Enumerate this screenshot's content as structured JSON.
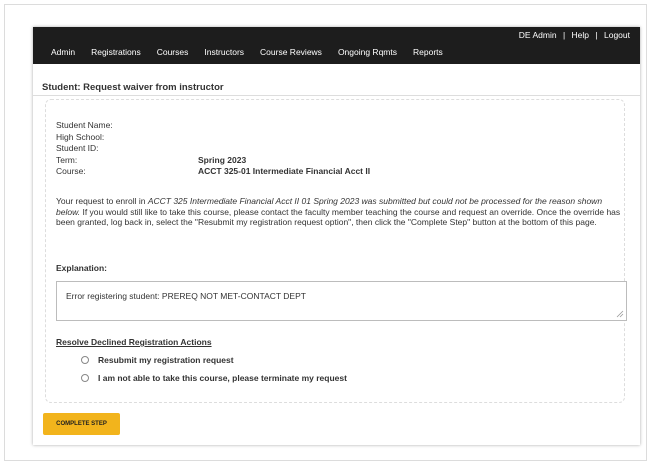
{
  "header": {
    "user_links": [
      "DE Admin",
      "Help",
      "Logout"
    ],
    "separator": "|",
    "menu": [
      "Admin",
      "Registrations",
      "Courses",
      "Instructors",
      "Course Reviews",
      "Ongoing Rqmts",
      "Reports"
    ]
  },
  "page": {
    "title": "Student: Request waiver from instructor"
  },
  "student_info": {
    "name_label": "Student Name:",
    "name_value": "",
    "school_label": "High School:",
    "school_value": "",
    "id_label": "Student ID:",
    "id_value": "",
    "term_label": "Term:",
    "term_value": "Spring 2023",
    "course_label": "Course:",
    "course_value": "ACCT 325-01 Intermediate Financial Acct II"
  },
  "message": {
    "lead": "Your request to enroll in ",
    "italic": "ACCT 325 Intermediate Financial Acct II 01 Spring 2023 was submitted but could not be processed for the reason shown below.",
    "rest": " If you would still like to take this course, please contact the faculty member teaching the course and request an override. Once the override has been granted, log back in, select the \"Resubmit my registration request option\", then click the \"Complete Step\" button at the bottom of this page."
  },
  "explanation": {
    "label": "Explanation:",
    "text": "Error registering student: PREREQ NOT MET-CONTACT DEPT"
  },
  "resolve": {
    "heading": "Resolve Declined Registration Actions",
    "options": [
      {
        "label": "Resubmit my registration request",
        "selected": false
      },
      {
        "label": "I am not able to take this course, please terminate my request",
        "selected": false
      }
    ]
  },
  "actions": {
    "complete_label": "COMPLETE STEP"
  },
  "colors": {
    "nav_background": "#1d1d1d",
    "button_accent": "#f2b41c"
  }
}
